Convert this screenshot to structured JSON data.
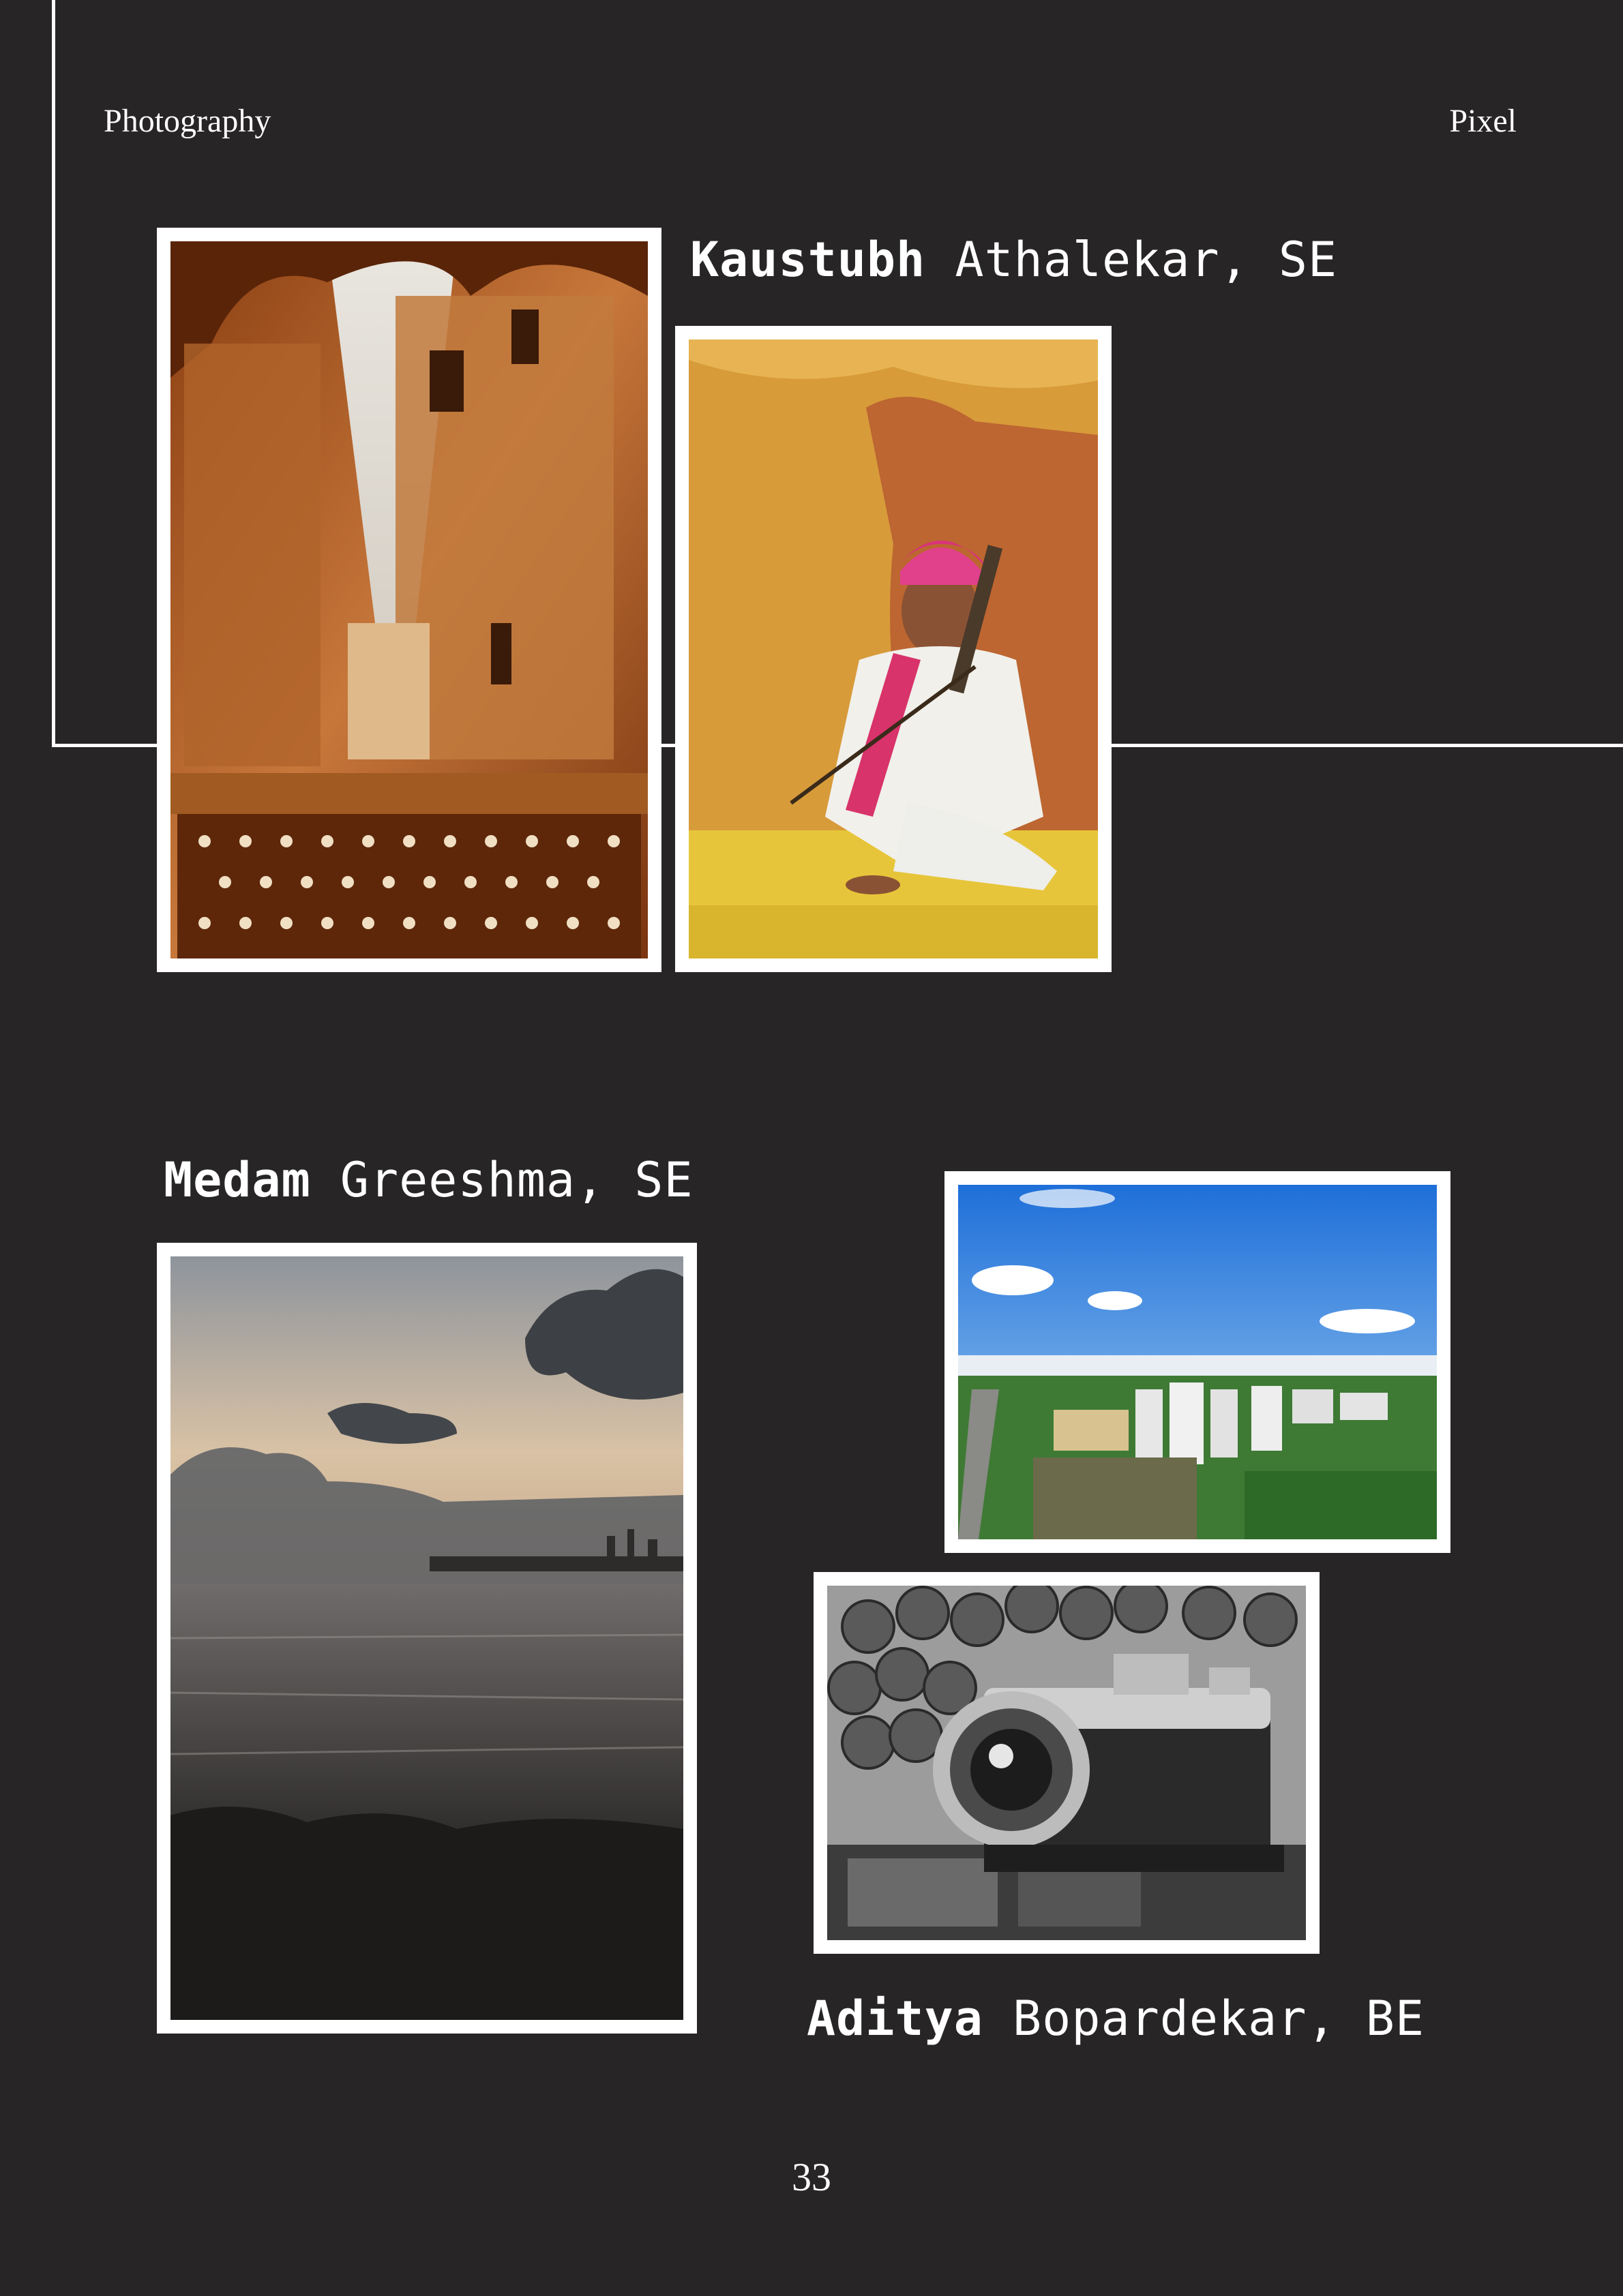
{
  "header": {
    "section": "Photography",
    "magazine": "Pixel"
  },
  "credits": [
    {
      "first": "Kaustubh",
      "rest": "Athalekar, SE"
    },
    {
      "first": "Medam",
      "rest": "Greeshma, SE"
    },
    {
      "first": "Aditya",
      "rest": "Bopardekar, BE"
    }
  ],
  "photos": [
    {
      "subject": "ornate sandstone havelis framed by a carved archway over a busy lane"
    },
    {
      "subject": "man in pink turban and white clothes holding a string instrument against an ochre wall"
    },
    {
      "subject": "dusk sea view with clouds and distant city skyline over rocks"
    },
    {
      "subject": "aerial view of green city with high-rise apartments under blue sky"
    },
    {
      "subject": "black-and-white vintage camera resting on stacked logs"
    }
  ],
  "page_number": "33",
  "colors": {
    "background": "#272526",
    "frame": "#ffffff",
    "text": "#ffffff"
  }
}
